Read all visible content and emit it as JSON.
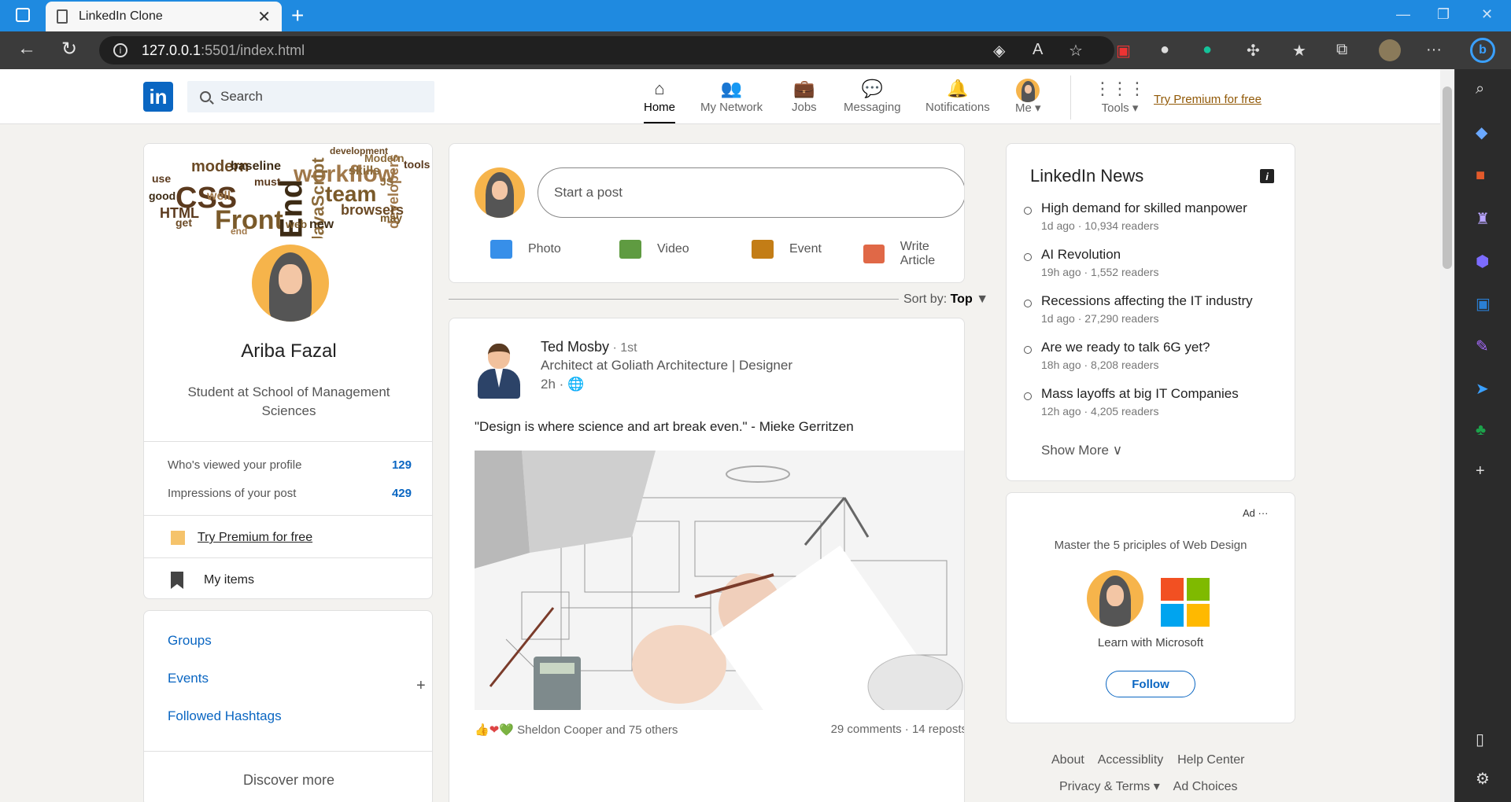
{
  "browser": {
    "tab_title": "LinkedIn Clone",
    "url_host": "127.0.0.1",
    "url_path": ":5501/index.html"
  },
  "header": {
    "logo": "in",
    "search_placeholder": "Search",
    "nav": [
      {
        "label": "Home",
        "icon": "home-icon"
      },
      {
        "label": "My Network",
        "icon": "network-icon"
      },
      {
        "label": "Jobs",
        "icon": "briefcase-icon"
      },
      {
        "label": "Messaging",
        "icon": "message-icon"
      },
      {
        "label": "Notifications",
        "icon": "bell-icon"
      },
      {
        "label": "Me ▾",
        "icon": "avatar"
      },
      {
        "label": "Tools ▾",
        "icon": "grid-icon"
      }
    ],
    "premium_link": "Try Premium for free"
  },
  "profile": {
    "name": "Ariba Fazal",
    "title": "Student at School of Management Sciences",
    "stats": [
      {
        "label": "Who's viewed your profile",
        "value": "129"
      },
      {
        "label": "Impressions of your post",
        "value": "429"
      }
    ],
    "premium": "Try Premium for free",
    "my_items": "My items"
  },
  "groups": {
    "links": [
      "Groups",
      "Events",
      "Followed Hashtags"
    ],
    "discover": "Discover more"
  },
  "composer": {
    "placeholder": "Start a post",
    "actions": [
      {
        "label": "Photo",
        "color": "#378fe9"
      },
      {
        "label": "Video",
        "color": "#5f9b41"
      },
      {
        "label": "Event",
        "color": "#c37d16"
      },
      {
        "label": "Write Article",
        "color": "#e06847"
      }
    ]
  },
  "sort": {
    "label": "Sort by:",
    "value": "Top"
  },
  "post": {
    "author": "Ted Mosby",
    "degree": " · 1st",
    "role": "Architect at Goliath Architecture | Designer",
    "time": "2h · 🌐",
    "text": "\"Design is where science and art break even.\" - Mieke Gerritzen",
    "reactions": "Sheldon Cooper and 75 others",
    "engagement": "29 comments · 14 reposts"
  },
  "news": {
    "title": "LinkedIn News",
    "items": [
      {
        "title": "High demand for skilled manpower",
        "meta": "1d ago · 10,934 readers"
      },
      {
        "title": "AI Revolution",
        "meta": "19h ago · 1,552 readers"
      },
      {
        "title": "Recessions affecting the IT industry",
        "meta": "1d ago · 27,290 readers"
      },
      {
        "title": "Are we ready to talk 6G yet?",
        "meta": "18h ago · 8,208 readers"
      },
      {
        "title": "Mass layoffs at big IT Companies",
        "meta": "12h ago · 4,205 readers"
      }
    ],
    "show_more": "Show More ∨"
  },
  "ad": {
    "label": "Ad ···",
    "text": "Master the 5 priciples of Web Design",
    "subtitle": "Learn with Microsoft",
    "follow": "Follow"
  },
  "footer": {
    "row1": [
      "About",
      "Accessiblity",
      "Help Center"
    ],
    "row2": [
      "Privacy & Terms ▾",
      "Ad Choices"
    ]
  },
  "cover_words": [
    "CSS",
    "Front",
    "End",
    "workflow",
    "modern",
    "JavaScript",
    "HTML",
    "team",
    "baseline",
    "developers",
    "browsers",
    "skills",
    "use",
    "web",
    "good",
    "well",
    "get",
    "JS",
    "must",
    "may",
    "new",
    "end",
    "development",
    "Modern",
    "tools"
  ]
}
